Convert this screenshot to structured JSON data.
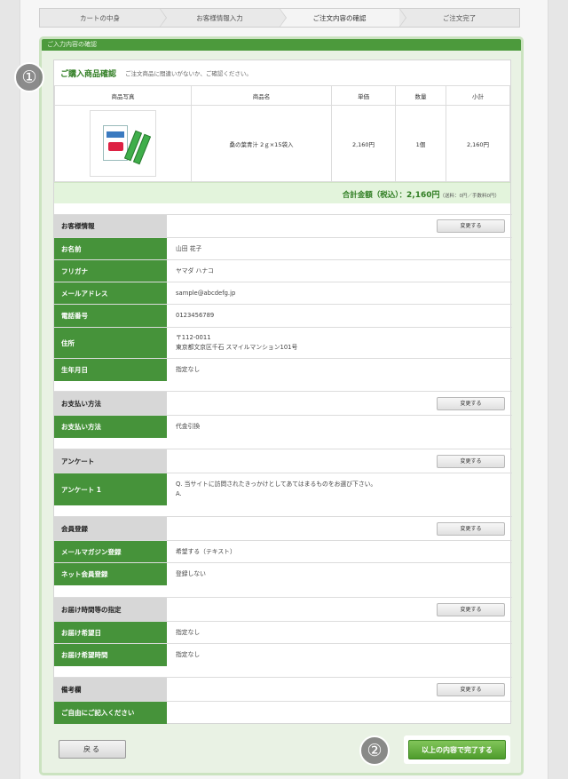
{
  "steps": [
    "カートの中身",
    "お客様情報入力",
    "ご注文内容の確認",
    "ご注文完了"
  ],
  "frame_title": "ご入力内容の確認",
  "badges": {
    "one": "①",
    "two": "②"
  },
  "cart": {
    "title": "ご購入商品確認",
    "subtitle": "ご注文商品に間違いがないか、ご確認ください。",
    "headers": [
      "商品写真",
      "商品名",
      "単価",
      "数量",
      "小計"
    ],
    "item": {
      "image_label": "桑の葉青汁",
      "name": "桑の葉青汁 2ｇ×15袋入",
      "price": "2,160円",
      "qty": "1個",
      "subtotal": "2,160円"
    },
    "total_label": "合計金額（税込）：",
    "total_amount": "2,160円",
    "total_note": "（送料：0円／手数料0円）"
  },
  "change_label": "変更する",
  "customer": {
    "heading": "お客様情報",
    "rows": [
      {
        "label": "お名前",
        "value": "山田 花子"
      },
      {
        "label": "フリガナ",
        "value": "ヤマダ ハナコ"
      },
      {
        "label": "メールアドレス",
        "value": "sample@abcdefg.jp"
      },
      {
        "label": "電話番号",
        "value": "0123456789"
      },
      {
        "label": "住所",
        "value": "〒112-0011",
        "value2": "東京都文京区千石 スマイルマンション101号"
      },
      {
        "label": "生年月日",
        "value": "指定なし"
      }
    ]
  },
  "payment": {
    "heading": "お支払い方法",
    "label": "お支払い方法",
    "value": "代金引換"
  },
  "survey": {
    "heading": "アンケート",
    "label": "アンケート 1",
    "q": "Q. 当サイトに訪問されたきっかけとしてあてはまるものをお選び下さい。",
    "a": "A."
  },
  "member": {
    "heading": "会員登録",
    "rows": [
      {
        "label": "メールマガジン登録",
        "value": "希望する（テキスト）"
      },
      {
        "label": "ネット会員登録",
        "value": "登録しない"
      }
    ]
  },
  "delivery": {
    "heading": "お届け時間等の指定",
    "rows": [
      {
        "label": "お届け希望日",
        "value": "指定なし"
      },
      {
        "label": "お届け希望時間",
        "value": "指定なし"
      }
    ]
  },
  "notes": {
    "heading": "備考欄",
    "label": "ご自由にご記入ください",
    "value": ""
  },
  "buttons": {
    "back": "戻る",
    "complete": "以上の内容で完了する"
  }
}
